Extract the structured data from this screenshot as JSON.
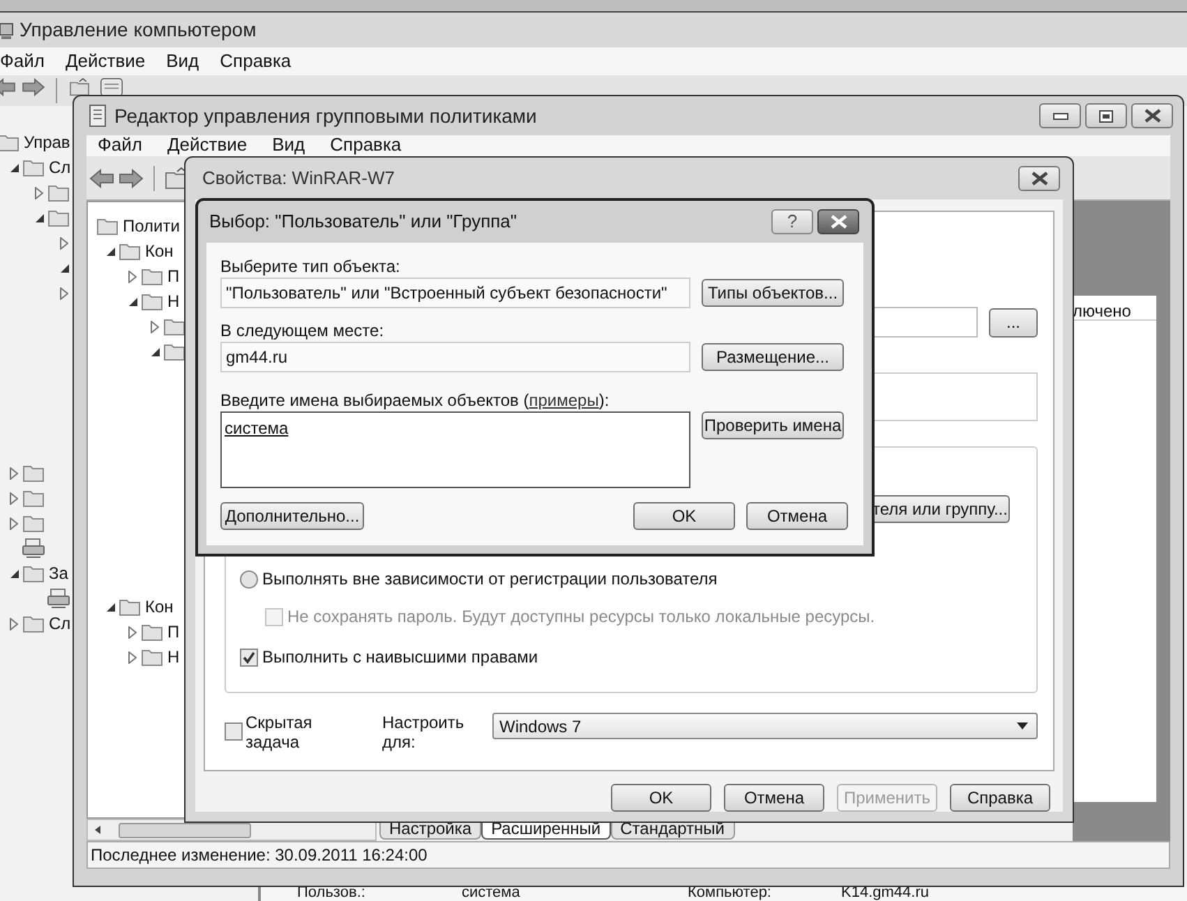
{
  "computer_management": {
    "title": "Управление компьютером",
    "menu": [
      "Файл",
      "Действие",
      "Вид",
      "Справка"
    ],
    "tree": [
      {
        "label": "Управ",
        "children": [
          {
            "label": "Сл",
            "expanded": true,
            "children": [
              {
                "expanded": false
              },
              {
                "expanded": true,
                "children": [
                  {
                    "expanded": false
                  },
                  {
                    "expanded": true
                  },
                  {
                    "expanded": false
                  }
                ]
              }
            ]
          },
          {
            "expanded": false
          },
          {
            "expanded": false
          },
          {
            "expanded": false
          },
          {
            "kind": "leaf"
          },
          {
            "label": "За",
            "expanded": true,
            "children": [
              {
                "kind": "leaf"
              }
            ]
          },
          {
            "label": "Сл",
            "expanded": false
          }
        ]
      }
    ]
  },
  "gpo_editor": {
    "title": "Редактор управления групповыми политиками",
    "menu": [
      "Файл",
      "Действие",
      "Вид",
      "Справка"
    ],
    "tree": [
      {
        "label": "Полити",
        "children": [
          {
            "label": "Кон",
            "expanded": true,
            "children": [
              {
                "label": "П",
                "expanded": false
              },
              {
                "label": "Н",
                "expanded": true,
                "children": [
                  {
                    "expanded": false
                  },
                  {
                    "expanded": true
                  }
                ]
              }
            ]
          },
          {
            "label": "Кон",
            "expanded": true,
            "children": [
              {
                "label": "П",
                "expanded": false
              },
              {
                "label": "Н",
                "expanded": false
              }
            ]
          }
        ]
      }
    ],
    "tabs": [
      {
        "label": "Настройка",
        "selected": false
      },
      {
        "label": "Расширенный",
        "selected": true
      },
      {
        "label": "Стандартный",
        "selected": false
      }
    ],
    "list_header": "лючено",
    "status": "Последнее изменение: 30.09.2011 16:24:00"
  },
  "properties_dialog": {
    "title": "Свойства: WinRAR-W7",
    "browse_button": "...",
    "user_button": "теля или группу...",
    "options": [
      {
        "kind": "radio",
        "label": "Выполнять вне зависимости от регистрации пользователя",
        "selected": false,
        "children": [
          {
            "kind": "checkbox",
            "label": "Не сохранять пароль. Будут доступны ресурсы только локальные ресурсы.",
            "checked": false,
            "disabled": true
          }
        ]
      },
      {
        "kind": "checkbox",
        "label": "Выполнить с наивысшими правами",
        "checked": true,
        "disabled": false
      }
    ],
    "hidden_task": {
      "label": "Скрытая задача",
      "checked": false
    },
    "configure_for": {
      "label": "Настроить для:",
      "value": "Windows 7"
    },
    "buttons": [
      {
        "label": "OK",
        "disabled": false
      },
      {
        "label": "Отмена",
        "disabled": false
      },
      {
        "label": "Применить",
        "disabled": true
      },
      {
        "label": "Справка",
        "disabled": false
      }
    ]
  },
  "select_dialog": {
    "title": "Выбор: \"Пользователь\" или \"Группа\"",
    "help_button": "?",
    "fields": [
      {
        "label": "Выберите тип объекта:",
        "value": "\"Пользователь\" или \"Встроенный субъект безопасности\"",
        "button": "Типы объектов..."
      },
      {
        "label": "В следующем месте:",
        "value": "gm44.ru",
        "button": "Размещение..."
      }
    ],
    "names": {
      "label": "Введите имена выбираемых объектов (",
      "link": "примеры",
      "label_end": "):",
      "value": "система",
      "button": "Проверить имена"
    },
    "advanced_button": "Дополнительно...",
    "buttons": [
      "OK",
      "Отмена"
    ]
  },
  "background_details": [
    {
      "label": "Пользов.:",
      "value": "система"
    },
    {
      "label": "Компьютер:",
      "value": "K14.gm44.ru"
    }
  ]
}
